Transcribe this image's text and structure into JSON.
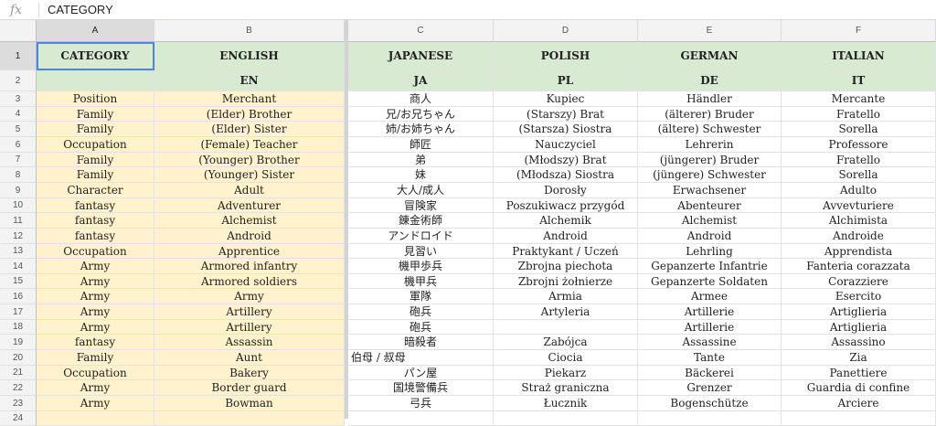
{
  "formula_bar": {
    "icon": "fx",
    "value": "CATEGORY"
  },
  "column_letters": [
    "A",
    "B",
    "C",
    "D",
    "E",
    "F"
  ],
  "row_numbers": [
    "1",
    "2",
    "3",
    "4",
    "5",
    "6",
    "7",
    "8",
    "9",
    "10",
    "11",
    "12",
    "13",
    "14",
    "15",
    "16",
    "17",
    "18",
    "19",
    "20",
    "21",
    "22",
    "23",
    "24"
  ],
  "header_row": [
    "CATEGORY",
    "ENGLISH",
    "JAPANESE",
    "POLISH",
    "GERMAN",
    "ITALIAN"
  ],
  "code_row": [
    "",
    "EN",
    "JA",
    "PL",
    "DE",
    "IT"
  ],
  "rows": [
    [
      "Position",
      "Merchant",
      "商人",
      "Kupiec",
      "Händler",
      "Mercante"
    ],
    [
      "Family",
      "(Elder) Brother",
      "兄/お兄ちゃん",
      "(Starszy) Brat",
      "(älterer) Bruder",
      "Fratello"
    ],
    [
      "Family",
      "(Elder) Sister",
      "姉/お姉ちゃん",
      "(Starsza) Siostra",
      "(ältere) Schwester",
      "Sorella"
    ],
    [
      "Occupation",
      "(Female) Teacher",
      "師匠",
      "Nauczyciel",
      "Lehrerin",
      "Professore"
    ],
    [
      "Family",
      "(Younger) Brother",
      "弟",
      "(Młodszy) Brat",
      "(jüngerer) Bruder",
      "Fratello"
    ],
    [
      "Family",
      "(Younger) Sister",
      "妹",
      "(Młodsza) Siostra",
      "(jüngere) Schwester",
      "Sorella"
    ],
    [
      "Character",
      "Adult",
      "大人/成人",
      "Dorosły",
      "Erwachsener",
      "Adulto"
    ],
    [
      "fantasy",
      "Adventurer",
      "冒険家",
      "Poszukiwacz przygód",
      "Abenteurer",
      "Avvevturiere"
    ],
    [
      "fantasy",
      "Alchemist",
      "錬金術師",
      "Alchemik",
      "Alchemist",
      "Alchimista"
    ],
    [
      "fantasy",
      "Android",
      "アンドロイド",
      "Android",
      "Android",
      "Androide"
    ],
    [
      "Occupation",
      "Apprentice",
      "見習い",
      "Praktykant / Uczeń",
      "Lehrling",
      "Apprendista"
    ],
    [
      "Army",
      "Armored infantry",
      "機甲歩兵",
      "Zbrojna piechota",
      "Gepanzerte Infantrie",
      "Fanteria corazzata"
    ],
    [
      "Army",
      "Armored soldiers",
      "機甲兵",
      "Zbrojni żołnierze",
      "Gepanzerte Soldaten",
      "Corazziere"
    ],
    [
      "Army",
      "Army",
      "軍隊",
      "Armia",
      "Armee",
      "Esercito"
    ],
    [
      "Army",
      "Artillery",
      "砲兵",
      "Artyleria",
      "Artillerie",
      "Artiglieria"
    ],
    [
      "Army",
      "Artillery",
      "砲兵",
      "",
      "Artillerie",
      "Artiglieria"
    ],
    [
      "fantasy",
      "Assassin",
      "暗殺者",
      "Zabójca",
      "Assassine",
      "Assassino"
    ],
    [
      "Family",
      "Aunt",
      "伯母 / 叔母",
      "Ciocia",
      "Tante",
      "Zia"
    ],
    [
      "Occupation",
      "Bakery",
      "パン屋",
      "Piekarz",
      "Bäckerei",
      "Panettiere"
    ],
    [
      "Army",
      "Border guard",
      "国境警備兵",
      "Straż graniczna",
      "Grenzer",
      "Guardia di confine"
    ],
    [
      "Army",
      "Bowman",
      "弓兵",
      "Łucznik",
      "Bogenschütze",
      "Arciere"
    ],
    [
      "",
      "",
      "",
      "",
      "",
      ""
    ]
  ],
  "colors": {
    "header_green": "#d9ead3",
    "frozen_yellow": "#fff2cc",
    "selection_blue": "#4a86e8",
    "header_gray": "#f3f3f3"
  }
}
